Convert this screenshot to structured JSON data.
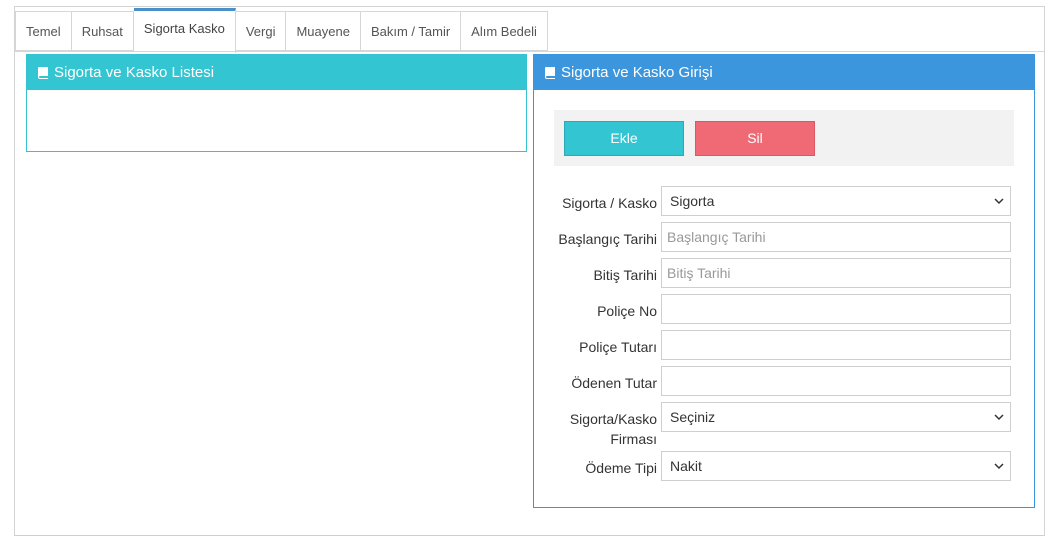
{
  "tabs": [
    {
      "label": "Temel"
    },
    {
      "label": "Ruhsat"
    },
    {
      "label": "Sigorta Kasko",
      "active": true
    },
    {
      "label": "Vergi"
    },
    {
      "label": "Muayene"
    },
    {
      "label": "Bakım / Tamir"
    },
    {
      "label": "Alım Bedeli"
    }
  ],
  "left_panel": {
    "title": "Sigorta ve Kasko Listesi",
    "icon": "book-icon"
  },
  "right_panel": {
    "title": "Sigorta ve Kasko Girişi",
    "icon": "book-icon"
  },
  "buttons": {
    "add": "Ekle",
    "delete": "Sil"
  },
  "form": {
    "type": {
      "label": "Sigorta / Kasko",
      "value": "Sigorta"
    },
    "start_date": {
      "label": "Başlangıç Tarihi",
      "placeholder": "Başlangıç Tarihi",
      "value": ""
    },
    "end_date": {
      "label": "Bitiş Tarihi",
      "placeholder": "Bitiş Tarihi",
      "value": ""
    },
    "policy_no": {
      "label": "Poliçe No",
      "value": ""
    },
    "policy_amount": {
      "label": "Poliçe Tutarı",
      "value": ""
    },
    "paid_amount": {
      "label": "Ödenen Tutar",
      "value": ""
    },
    "company": {
      "label_line1": "Sigorta/Kasko",
      "label_line2": "Firması",
      "value": "Seçiniz"
    },
    "payment_type": {
      "label": "Ödeme Tipi",
      "value": "Nakit"
    }
  },
  "colors": {
    "cyan": "#33c5d2",
    "blue": "#3b96dd",
    "red": "#ef6a75",
    "active_tab": "#4a90c8"
  }
}
